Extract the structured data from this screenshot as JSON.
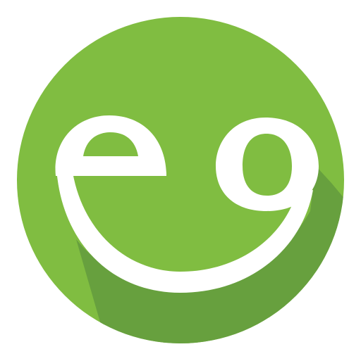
{
  "logo": {
    "icon": "smiley-eo-logo-icon",
    "letters": "eo",
    "colors": {
      "background": "#ffffff",
      "circle": "#80bd41",
      "shadow": "#67a03e",
      "glyph": "#ffffff"
    }
  }
}
